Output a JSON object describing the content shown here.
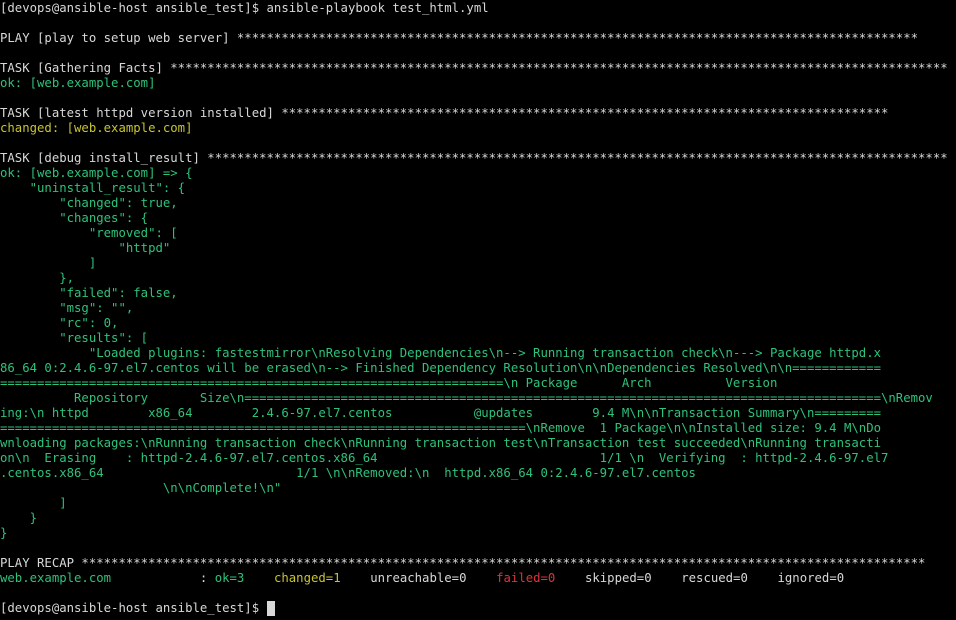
{
  "terminal": {
    "colors": {
      "background": "#000000",
      "foreground": "#d8d8d8",
      "ok": "#2ec27a",
      "changed": "#c8c431",
      "failed": "#e0323a"
    },
    "prompt_top": "[devops@ansible-host ansible_test]$ ansible-playbook test_html.yml",
    "play_header": "PLAY [play to setup web server] ********************************************************************************************",
    "task1_header": "TASK [Gathering Facts] *********************************************************************************************************",
    "task1_result": "ok: [web.example.com]",
    "task2_header": "TASK [latest httpd version installed] **********************************************************************************",
    "task2_result": "changed: [web.example.com]",
    "task3_header": "TASK [debug install_result] ****************************************************************************************************",
    "debug_lines": [
      "ok: [web.example.com] => {",
      "    \"uninstall_result\": {",
      "        \"changed\": true,",
      "        \"changes\": {",
      "            \"removed\": [",
      "                \"httpd\"",
      "            ]",
      "        },",
      "        \"failed\": false,",
      "        \"msg\": \"\",",
      "        \"rc\": 0,",
      "        \"results\": [",
      "            \"Loaded plugins: fastestmirror\\nResolving Dependencies\\n--> Running transaction check\\n---> Package httpd.x",
      "86_64 0:2.4.6-97.el7.centos will be erased\\n--> Finished Dependency Resolution\\n\\nDependencies Resolved\\n\\n============",
      "====================================================================\\n Package      Arch          Version",
      "          Repository       Size\\n======================================================================================\\nRemov",
      "ing:\\n httpd        x86_64        2.4.6-97.el7.centos           @updates        9.4 M\\n\\nTransaction Summary\\n=========",
      "=======================================================================\\nRemove  1 Package\\n\\nInstalled size: 9.4 M\\nDo",
      "wnloading packages:\\nRunning transaction check\\nRunning transaction test\\nTransaction test succeeded\\nRunning transacti",
      "on\\n  Erasing    : httpd-2.4.6-97.el7.centos.x86_64                              1/1 \\n  Verifying  : httpd-2.4.6-97.el7",
      ".centos.x86_64                          1/1 \\n\\nRemoved:\\n  httpd.x86_64 0:2.4.6-97.el7.centos",
      "                      \\n\\nComplete!\\n\"",
      "        ]",
      "    }",
      "}"
    ],
    "recap_header": "PLAY RECAP ******************************************************************************************************************",
    "recap": {
      "host": "web.example.com",
      "separator": "            : ",
      "ok": "ok=3",
      "changed": "changed=1",
      "unreachable": "unreachable=0",
      "failed": "failed=0",
      "skipped": "skipped=0",
      "rescued": "rescued=0",
      "ignored": "ignored=0"
    },
    "prompt_bottom": "[devops@ansible-host ansible_test]$ "
  }
}
